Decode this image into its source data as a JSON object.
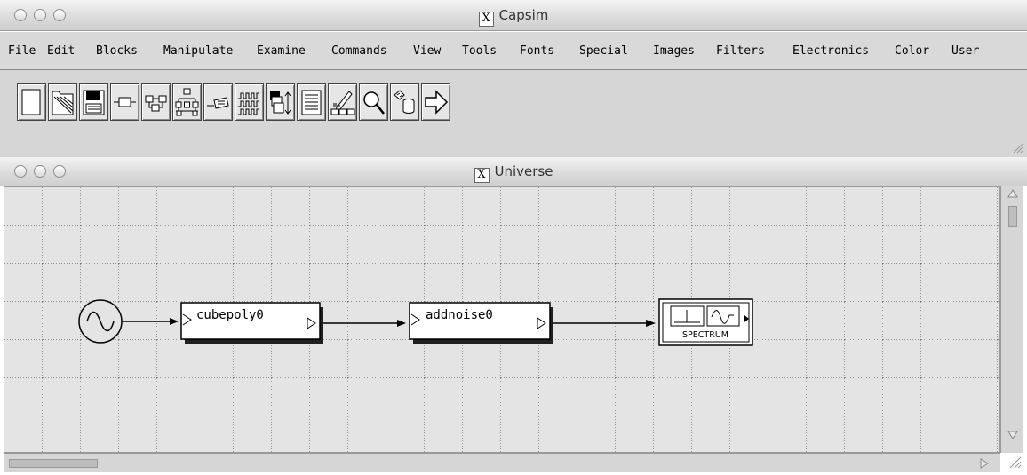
{
  "windows": {
    "main_title": "Capsim",
    "universe_title": "Universe",
    "x_logo": "X"
  },
  "menubar": {
    "items": [
      "File",
      "Edit",
      "Blocks",
      "Manipulate",
      "Examine",
      "Commands",
      "View",
      "Tools",
      "Fonts",
      "Special",
      "Images",
      "Filters",
      "Electronics",
      "Color",
      "User"
    ]
  },
  "toolbar": {
    "icons": [
      "new-file-icon",
      "open-file-icon",
      "save-file-icon",
      "add-block-icon",
      "connect-blocks-icon",
      "hierarchy-icon",
      "parameter-icon",
      "waveform-icon",
      "arrange-icon",
      "text-list-icon",
      "edit-block-icon",
      "search-icon",
      "database-icon",
      "run-icon"
    ]
  },
  "diagram": {
    "blocks": [
      {
        "id": "source",
        "label": "",
        "icon": "sine-source-icon"
      },
      {
        "id": "cubepoly0",
        "label": "cubepoly0"
      },
      {
        "id": "addnoise0",
        "label": "addnoise0"
      },
      {
        "id": "spectrum",
        "label": "SPECTRUM"
      }
    ]
  }
}
